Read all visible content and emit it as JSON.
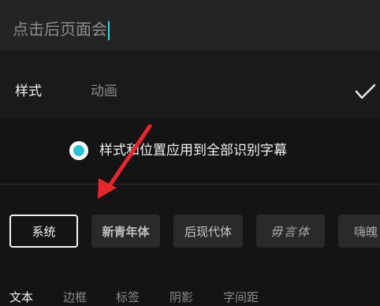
{
  "input": {
    "value": "点击后页面会"
  },
  "tabs": [
    {
      "label": "样式"
    },
    {
      "label": "动画"
    }
  ],
  "confirm_icon": "checkmark-icon",
  "apply_option": {
    "label": "样式和位置应用到全部识别字幕",
    "checked": true
  },
  "fonts": [
    {
      "label": "系统",
      "selected": true
    },
    {
      "label": "新青年体"
    },
    {
      "label": "后现代体"
    },
    {
      "label": "毋言体"
    },
    {
      "label": "嗨魄"
    }
  ],
  "subtabs": [
    {
      "label": "文本"
    },
    {
      "label": "边框"
    },
    {
      "label": "标签"
    },
    {
      "label": "阴影"
    },
    {
      "label": "字间距"
    }
  ],
  "colors": {
    "accent": "#27c3d8",
    "annotation_arrow": "#e8262b"
  }
}
